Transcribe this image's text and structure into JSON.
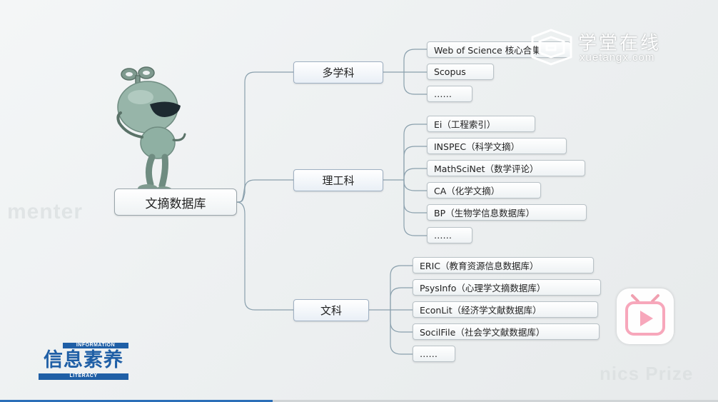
{
  "root": {
    "label": "文摘数据库"
  },
  "categories": [
    {
      "label": "多学科",
      "leaves": [
        "Web of Science 核心合集",
        "Scopus",
        "……"
      ]
    },
    {
      "label": "理工科",
      "leaves": [
        "Ei（工程索引）",
        "INSPEC（科学文摘）",
        "MathSciNet（数学评论）",
        "CA（化学文摘）",
        "BP（生物学信息数据库）",
        "……"
      ]
    },
    {
      "label": "文科",
      "leaves": [
        "ERIC（教育资源信息数据库）",
        "PsysInfo（心理学文摘数据库）",
        "EconLit（经济学文献数据库）",
        "SocilFile（社会学文献数据库）",
        "……"
      ]
    }
  ],
  "logo": {
    "top": "INFORMATION",
    "main": "信息素养",
    "bottom": "LITERACY"
  },
  "brand": {
    "cn": "学堂在线",
    "en": "xuetangx.com"
  },
  "player": {
    "progress_fraction": 0.38
  },
  "colors": {
    "line": "#8aa0ad",
    "logo_blue": "#1f5fa6",
    "mascot_body": "#8fb0a3"
  },
  "icons": {
    "play": "play-icon",
    "brand": "xuetangx-logo-icon",
    "mascot": "robot-mascot-icon"
  }
}
